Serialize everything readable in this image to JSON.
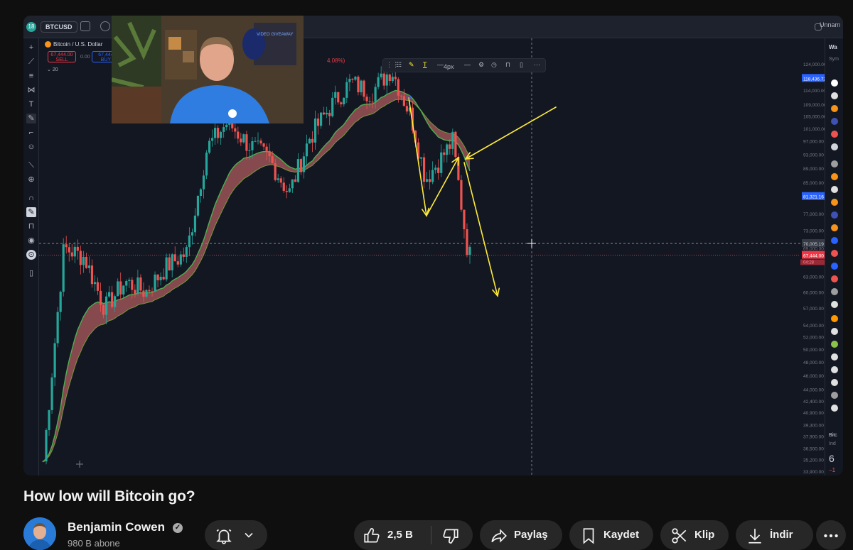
{
  "tradingview": {
    "symbol": "BTCUSD",
    "badge": "18",
    "legend_title": "Bitcoin / U.S. Dollar",
    "sell_price": "67,444.00",
    "sell_label": "SELL",
    "buy_price": "67,444",
    "buy_label": "BUY",
    "spread": "0.00",
    "indicator_value": "20",
    "change_pct": "4.08%)",
    "save_label": "Unnam",
    "draw_toolbar": {
      "stroke_width": "4px"
    },
    "price_labels": [
      "124,000.00",
      "118,436.72",
      "114,000.00",
      "109,000.00",
      "105,000.00",
      "101,000.00",
      "97,000.00",
      "93,000.00",
      "89,000.00",
      "85,000.00",
      "81,321.16",
      "77,000.00",
      "73,000.00",
      "70,005.19",
      "69,000.00",
      "67,444.00",
      "63,000.00",
      "60,000.00",
      "57,000.00",
      "54,000.00",
      "52,000.00",
      "50,000.00",
      "48,000.00",
      "46,000.00",
      "44,000.00",
      "42,400.00",
      "40,900.00",
      "39,300.00",
      "37,900.00",
      "36,500.00",
      "35,200.00",
      "33,900.00"
    ],
    "countdown": "04:28",
    "watchlist_header": "Wa",
    "watchlist_sub": "Sym",
    "detail_lines": [
      "Bitc",
      "Ind",
      "6",
      "−1"
    ],
    "colors": {
      "up": "#26a69a",
      "down": "#ef5350",
      "background": "#131722",
      "ribbon_green": "#4caf50",
      "ribbon_red": "#e57373",
      "annotation": "#ffeb3b"
    }
  },
  "chart_data": {
    "type": "candlestick",
    "series_name": "BTCUSD",
    "ylim": [
      33900,
      124000
    ],
    "key_levels": {
      "current": 67444,
      "cursor": 70005.19,
      "mark": 118436.72,
      "mark2": 81321.16
    },
    "path_approx": [
      {
        "x": 0,
        "y": 35000
      },
      {
        "x": 30,
        "y": 69000
      },
      {
        "x": 60,
        "y": 67000
      },
      {
        "x": 90,
        "y": 57000
      },
      {
        "x": 120,
        "y": 62000
      },
      {
        "x": 150,
        "y": 60000
      },
      {
        "x": 180,
        "y": 65000
      },
      {
        "x": 210,
        "y": 68000
      },
      {
        "x": 240,
        "y": 95000
      },
      {
        "x": 270,
        "y": 103000
      },
      {
        "x": 300,
        "y": 96000
      },
      {
        "x": 330,
        "y": 92000
      },
      {
        "x": 360,
        "y": 82000
      },
      {
        "x": 390,
        "y": 98000
      },
      {
        "x": 420,
        "y": 108000
      },
      {
        "x": 450,
        "y": 117000
      },
      {
        "x": 480,
        "y": 113000
      },
      {
        "x": 510,
        "y": 122000
      },
      {
        "x": 540,
        "y": 104000
      },
      {
        "x": 560,
        "y": 86000
      },
      {
        "x": 580,
        "y": 91000
      },
      {
        "x": 600,
        "y": 97000
      },
      {
        "x": 620,
        "y": 70000
      },
      {
        "x": 625,
        "y": 67444
      }
    ]
  },
  "video": {
    "title": "How low will Bitcoin go?",
    "webcam_overlay": "VIDEO GIVEAWAY"
  },
  "channel": {
    "name": "Benjamin Cowen",
    "subscribers": "980 B abone"
  },
  "actions": {
    "likes": "2,5 B",
    "share": "Paylaş",
    "save": "Kaydet",
    "clip": "Klip",
    "download": "İndir"
  }
}
